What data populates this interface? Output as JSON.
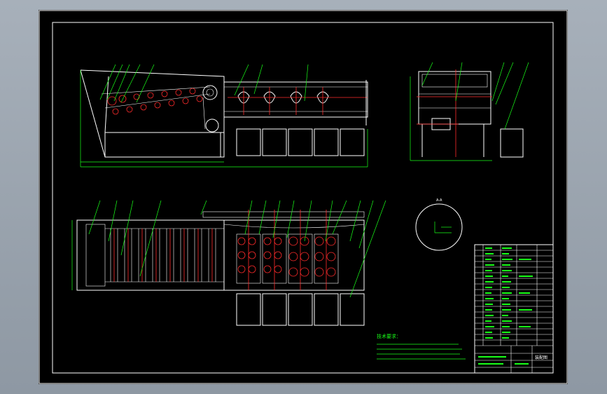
{
  "drawing": {
    "section_label": "A-A",
    "notes_title": "技术要求：",
    "title_block_title": "装配图"
  },
  "colors": {
    "background": "#9aa3ad",
    "sheet": "#000000",
    "lines": "#ffffff",
    "leaders": "#19ff19",
    "centerlines": "#ff2b2b"
  }
}
